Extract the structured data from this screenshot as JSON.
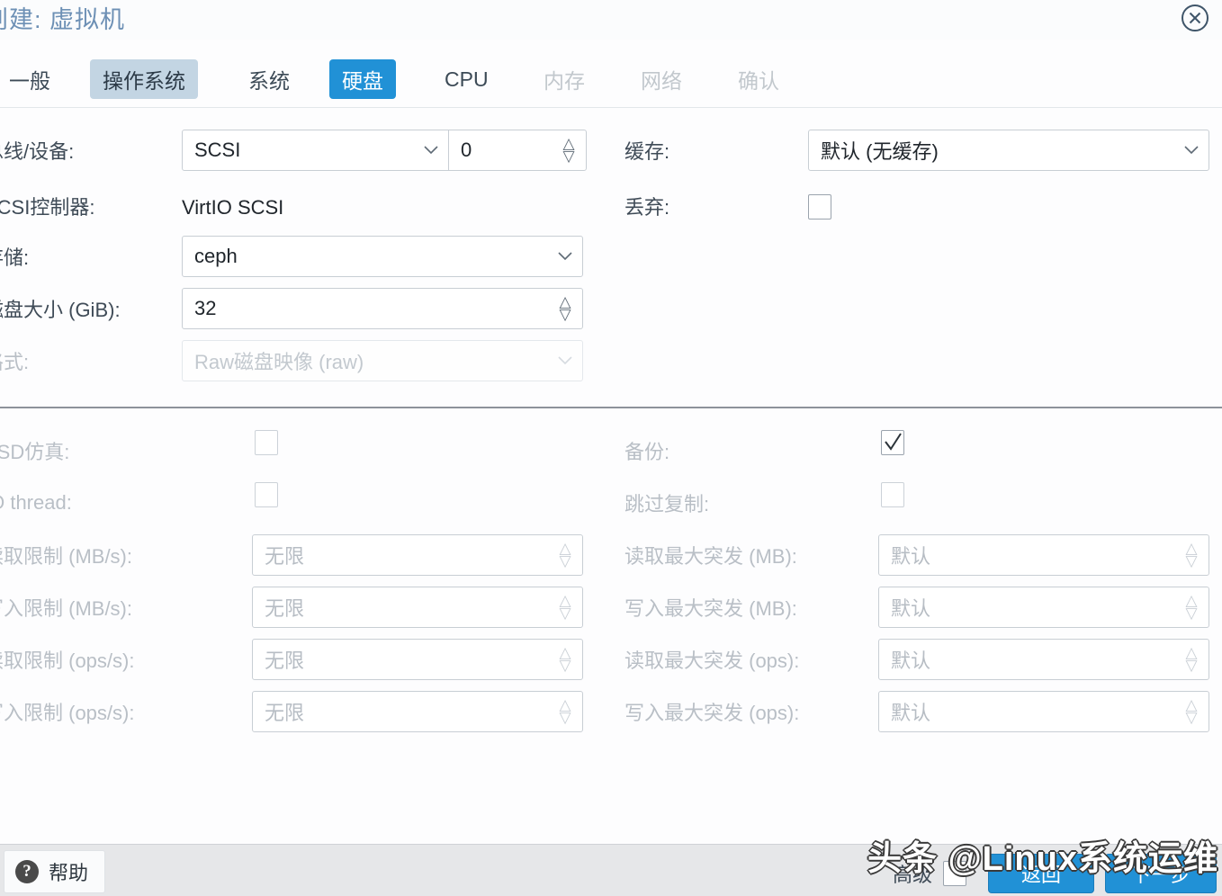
{
  "window": {
    "title": "创建: 虚拟机",
    "close_icon": "close-circle-icon"
  },
  "tabs": [
    {
      "label": "一般",
      "state": "normal"
    },
    {
      "label": "操作系统",
      "state": "hover"
    },
    {
      "label": "系统",
      "state": "normal"
    },
    {
      "label": "硬盘",
      "state": "active"
    },
    {
      "label": "CPU",
      "state": "normal"
    },
    {
      "label": "内存",
      "state": "disabled"
    },
    {
      "label": "网络",
      "state": "disabled"
    },
    {
      "label": "确认",
      "state": "disabled"
    }
  ],
  "form": {
    "left": {
      "bus_device": {
        "label": "总线/设备:",
        "bus_value": "SCSI",
        "device_value": "0"
      },
      "scsi_controller": {
        "label": "SCSI控制器:",
        "value": "VirtIO SCSI"
      },
      "storage": {
        "label": "存储:",
        "value": "ceph"
      },
      "disk_size": {
        "label": "磁盘大小 (GiB):",
        "value": "32"
      },
      "format": {
        "label": "格式:",
        "value": "Raw磁盘映像 (raw)",
        "disabled": true
      }
    },
    "right": {
      "cache": {
        "label": "缓存:",
        "value": "默认 (无缓存)"
      },
      "discard": {
        "label": "丢弃:",
        "checked": false
      }
    },
    "advanced_left": {
      "ssd_emulation": {
        "label": "SSD仿真:",
        "checked": false
      },
      "io_thread": {
        "label": "IO thread:",
        "checked": false
      },
      "read_limit_mb": {
        "label": "读取限制 (MB/s):",
        "placeholder": "无限"
      },
      "write_limit_mb": {
        "label": "写入限制 (MB/s):",
        "placeholder": "无限"
      },
      "read_limit_ops": {
        "label": "读取限制 (ops/s):",
        "placeholder": "无限"
      },
      "write_limit_ops": {
        "label": "写入限制 (ops/s):",
        "placeholder": "无限"
      }
    },
    "advanced_right": {
      "backup": {
        "label": "备份:",
        "checked": true
      },
      "skip_replicate": {
        "label": "跳过复制:",
        "checked": false
      },
      "read_burst_mb": {
        "label": "读取最大突发 (MB):",
        "placeholder": "默认"
      },
      "write_burst_mb": {
        "label": "写入最大突发 (MB):",
        "placeholder": "默认"
      },
      "read_burst_ops": {
        "label": "读取最大突发 (ops):",
        "placeholder": "默认"
      },
      "write_burst_ops": {
        "label": "写入最大突发 (ops):",
        "placeholder": "默认"
      }
    }
  },
  "footer": {
    "help_label": "帮助",
    "help_icon": "question-mark-icon",
    "advanced_label": "高级",
    "advanced_checked": false,
    "back_label": "返回",
    "next_label": "下一步"
  },
  "watermark": {
    "text": "头条 @Linux系统运维"
  },
  "colors": {
    "accent": "#2191d6",
    "tab_hover": "#c3d5e3",
    "title_text": "#6d90b5",
    "footer_bg": "#e6e7e9"
  }
}
